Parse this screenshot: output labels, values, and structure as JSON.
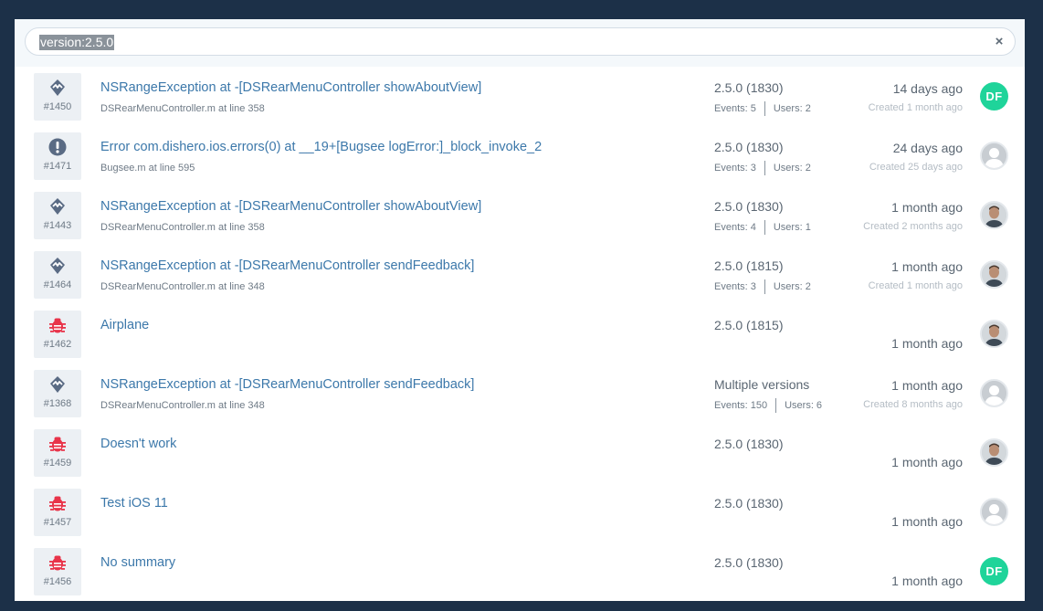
{
  "search": {
    "query": "version:2.5.0",
    "clear_label": "×"
  },
  "issues": [
    {
      "number": "#1450",
      "type": "crash",
      "title": "NSRangeException at -[DSRearMenuController showAboutView]",
      "location": "DSRearMenuController.m at line 358",
      "version": "2.5.0 (1830)",
      "events": "Events: 5",
      "users": "Users: 2",
      "time": "14 days ago",
      "created": "Created 1 month ago",
      "avatar": "initials",
      "avatar_text": "DF"
    },
    {
      "number": "#1471",
      "type": "error",
      "title": "Error com.dishero.ios.errors(0) at __19+[Bugsee logError:]_block_invoke_2",
      "location": "Bugsee.m at line 595",
      "version": "2.5.0 (1830)",
      "events": "Events: 3",
      "users": "Users: 2",
      "time": "24 days ago",
      "created": "Created 25 days ago",
      "avatar": "generic",
      "avatar_text": ""
    },
    {
      "number": "#1443",
      "type": "crash",
      "title": "NSRangeException at -[DSRearMenuController showAboutView]",
      "location": "DSRearMenuController.m at line 358",
      "version": "2.5.0 (1830)",
      "events": "Events: 4",
      "users": "Users: 1",
      "time": "1 month ago",
      "created": "Created 2 months ago",
      "avatar": "photo",
      "avatar_text": ""
    },
    {
      "number": "#1464",
      "type": "crash",
      "title": "NSRangeException at -[DSRearMenuController sendFeedback]",
      "location": "DSRearMenuController.m at line 348",
      "version": "2.5.0 (1815)",
      "events": "Events: 3",
      "users": "Users: 2",
      "time": "1 month ago",
      "created": "Created 1 month ago",
      "avatar": "photo",
      "avatar_text": ""
    },
    {
      "number": "#1462",
      "type": "bug",
      "title": "Airplane",
      "location": "",
      "version": "2.5.0 (1815)",
      "events": "",
      "users": "",
      "time": "1 month ago",
      "created": "",
      "avatar": "photo",
      "avatar_text": ""
    },
    {
      "number": "#1368",
      "type": "crash",
      "title": "NSRangeException at -[DSRearMenuController sendFeedback]",
      "location": "DSRearMenuController.m at line 348",
      "version": "Multiple versions",
      "events": "Events: 150",
      "users": "Users: 6",
      "time": "1 month ago",
      "created": "Created 8 months ago",
      "avatar": "generic",
      "avatar_text": ""
    },
    {
      "number": "#1459",
      "type": "bug",
      "title": "Doesn't work",
      "location": "",
      "version": "2.5.0 (1830)",
      "events": "",
      "users": "",
      "time": "1 month ago",
      "created": "",
      "avatar": "photo",
      "avatar_text": ""
    },
    {
      "number": "#1457",
      "type": "bug",
      "title": "Test iOS 11",
      "location": "",
      "version": "2.5.0 (1830)",
      "events": "",
      "users": "",
      "time": "1 month ago",
      "created": "",
      "avatar": "generic",
      "avatar_text": ""
    },
    {
      "number": "#1456",
      "type": "bug",
      "title": "No summary",
      "location": "",
      "version": "2.5.0 (1830)",
      "events": "",
      "users": "",
      "time": "1 month ago",
      "created": "",
      "avatar": "initials",
      "avatar_text": "DF"
    }
  ],
  "colors": {
    "backdrop": "#1c3048",
    "link": "#3c78aa",
    "crash_icon": "#5a6b84",
    "error_icon": "#5a6b84",
    "bug_icon": "#e8344a",
    "initials_avatar": "#1fd49a"
  },
  "icons": {
    "crash": "crash-icon",
    "error": "exclamation-icon",
    "bug": "bug-icon",
    "clear": "close-icon"
  }
}
